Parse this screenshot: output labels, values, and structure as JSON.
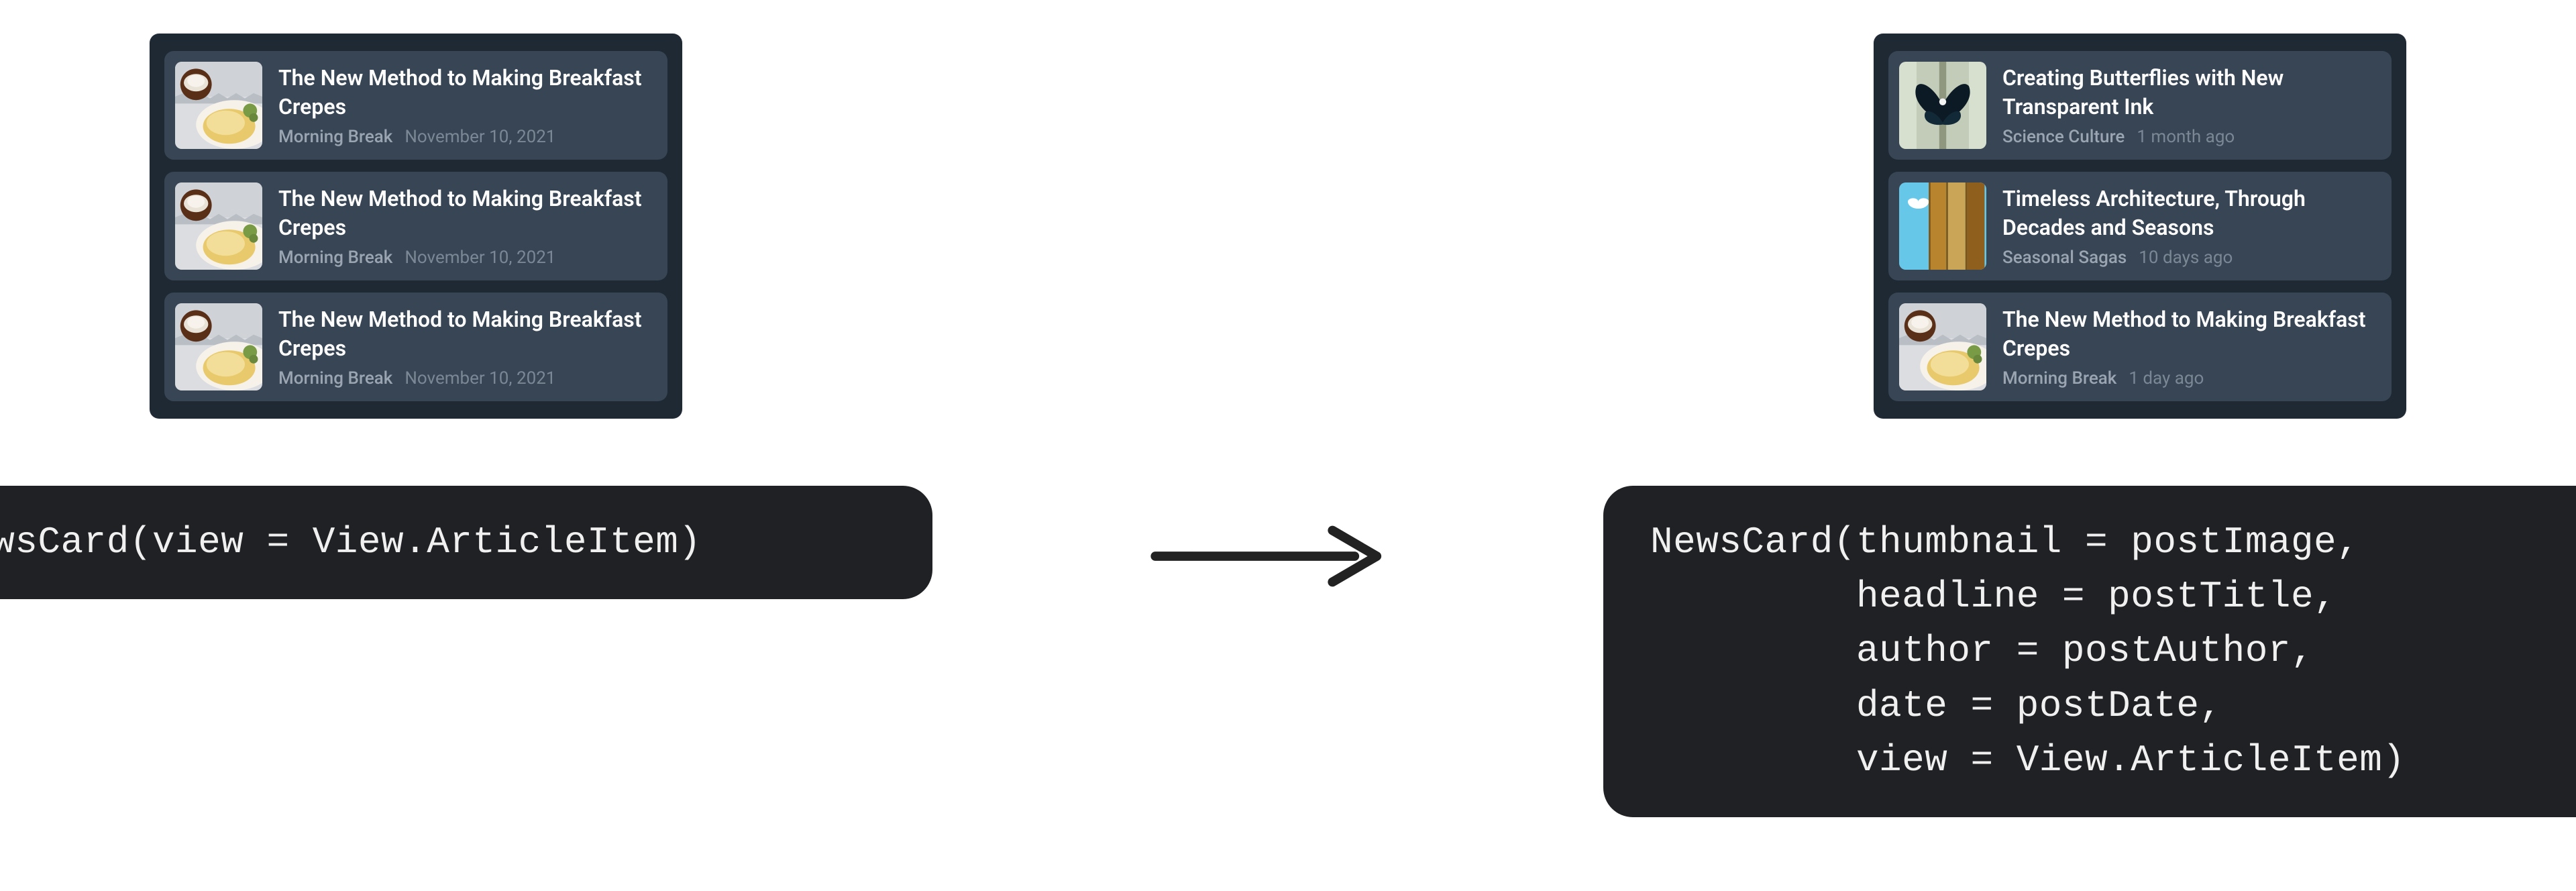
{
  "left_panel": {
    "items": [
      {
        "thumb": "crepes",
        "headline": "The New Method to Making Breakfast Crepes",
        "author": "Morning Break",
        "date": "November 10, 2021"
      },
      {
        "thumb": "crepes",
        "headline": "The New Method to Making Breakfast Crepes",
        "author": "Morning Break",
        "date": "November 10, 2021"
      },
      {
        "thumb": "crepes",
        "headline": "The New Method to Making Breakfast Crepes",
        "author": "Morning Break",
        "date": "November 10, 2021"
      }
    ]
  },
  "right_panel": {
    "items": [
      {
        "thumb": "butterfly",
        "headline": "Creating Butterflies with New Transparent Ink",
        "author": "Science Culture",
        "date": "1 month ago"
      },
      {
        "thumb": "arch",
        "headline": "Timeless Architecture, Through Decades and Seasons",
        "author": "Seasonal Sagas",
        "date": "10 days ago"
      },
      {
        "thumb": "crepes",
        "headline": "The New Method to Making Breakfast Crepes",
        "author": "Morning Break",
        "date": "1 day ago"
      }
    ]
  },
  "code": {
    "left": "NewsCard(view = View.ArticleItem)",
    "right": "NewsCard(thumbnail = postImage,\n         headline = postTitle,\n         author = postAuthor,\n         date = postDate,\n         view = View.ArticleItem)"
  }
}
